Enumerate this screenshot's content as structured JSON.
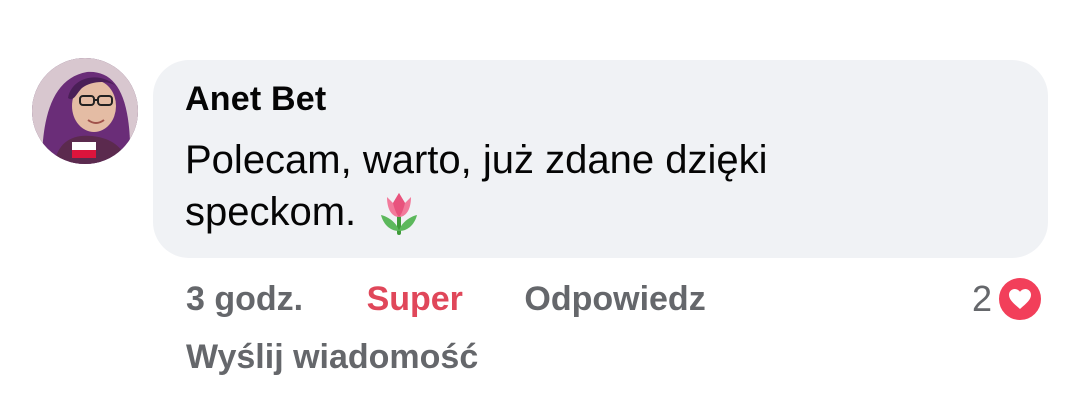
{
  "comment": {
    "author": "Anet Bet",
    "text": "Polecam, warto, już zdane dzięki speckom.",
    "emoji": "tulip"
  },
  "actions": {
    "time": "3 godz.",
    "reaction_label": "Super",
    "reply_label": "Odpowiedz",
    "message_label": "Wyślij wiadomość"
  },
  "reactions": {
    "count": "2",
    "type": "heart-icon"
  },
  "colors": {
    "bubble": "#f0f2f5",
    "reaction_active": "#e0475a",
    "secondary_text": "#65676b",
    "heart": "#f23f5a"
  }
}
